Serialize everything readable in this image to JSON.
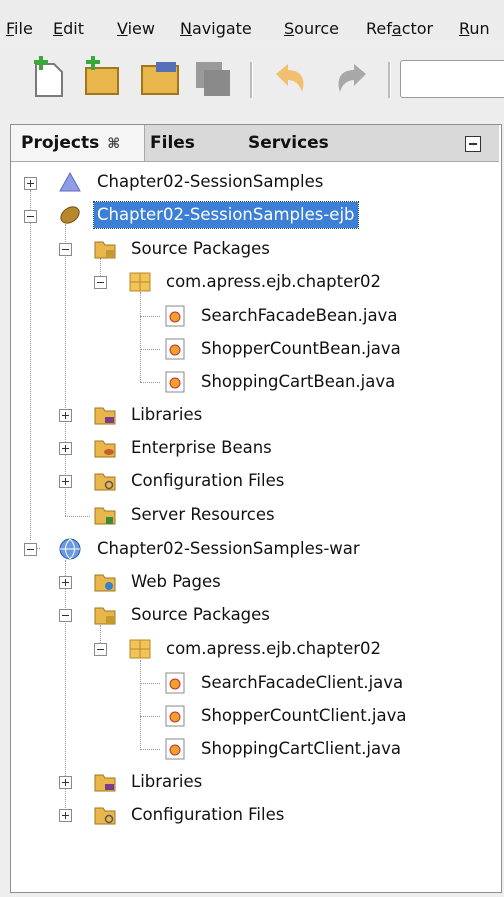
{
  "menu": [
    "File",
    "Edit",
    "View",
    "Navigate",
    "Source",
    "Refactor",
    "Run"
  ],
  "tabs": {
    "projects": "Projects",
    "files": "Files",
    "services": "Services",
    "close_glyph": "⌘"
  },
  "tree": [
    {
      "label": "Chapter02-SessionSamples",
      "icon": "project-triangle-icon"
    },
    {
      "label": "Chapter02-SessionSamples-ejb",
      "icon": "ejb-module-icon"
    },
    {
      "label": "Source Packages",
      "icon": "source-packages-icon"
    },
    {
      "label": "com.apress.ejb.chapter02",
      "icon": "package-icon"
    },
    {
      "label": "SearchFacadeBean.java",
      "icon": "java-file-icon"
    },
    {
      "label": "ShopperCountBean.java",
      "icon": "java-file-icon"
    },
    {
      "label": "ShoppingCartBean.java",
      "icon": "java-file-icon"
    },
    {
      "label": "Libraries",
      "icon": "libraries-icon"
    },
    {
      "label": "Enterprise Beans",
      "icon": "enterprise-beans-icon"
    },
    {
      "label": "Configuration Files",
      "icon": "configuration-files-icon"
    },
    {
      "label": "Server Resources",
      "icon": "server-resources-icon"
    },
    {
      "label": "Chapter02-SessionSamples-war",
      "icon": "web-module-icon"
    },
    {
      "label": "Web Pages",
      "icon": "web-pages-icon"
    },
    {
      "label": "Source Packages",
      "icon": "source-packages-icon"
    },
    {
      "label": "com.apress.ejb.chapter02",
      "icon": "package-icon"
    },
    {
      "label": "SearchFacadeClient.java",
      "icon": "java-file-icon"
    },
    {
      "label": "ShopperCountClient.java",
      "icon": "java-file-icon"
    },
    {
      "label": "ShoppingCartClient.java",
      "icon": "java-file-icon"
    },
    {
      "label": "Libraries",
      "icon": "libraries-icon"
    },
    {
      "label": "Configuration Files",
      "icon": "configuration-files-icon"
    }
  ],
  "colors": {
    "selection": "#3c7fd6",
    "folder": "#e8b64b",
    "package": "#f2c35a"
  }
}
